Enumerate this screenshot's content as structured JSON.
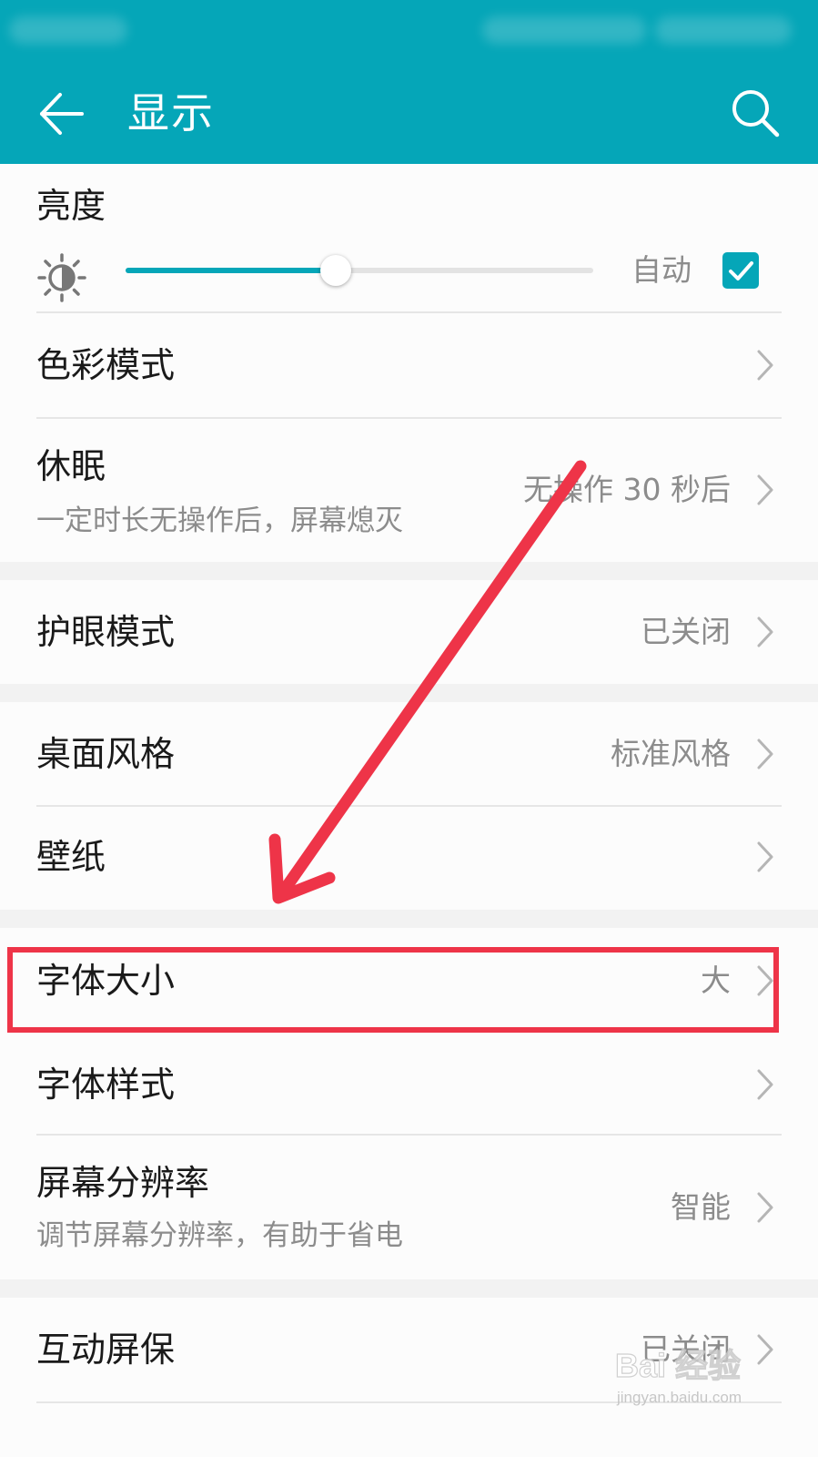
{
  "header": {
    "title": "显示"
  },
  "colors": {
    "accent": "#05a6b8",
    "annotation_red": "#ee3448"
  },
  "brightness": {
    "label": "亮度",
    "auto_label": "自动",
    "auto_checked": true,
    "level_fraction": 0.45
  },
  "settings": {
    "color_mode": {
      "label": "色彩模式"
    },
    "sleep": {
      "label": "休眠",
      "subtitle": "一定时长无操作后，屏幕熄灭",
      "value": "无操作 30 秒后"
    },
    "eye_comfort": {
      "label": "护眼模式",
      "value": "已关闭"
    },
    "home_style": {
      "label": "桌面风格",
      "value": "标准风格"
    },
    "wallpaper": {
      "label": "壁纸"
    },
    "font_size": {
      "label": "字体大小",
      "value": "大"
    },
    "font_style": {
      "label": "字体样式"
    },
    "resolution": {
      "label": "屏幕分辨率",
      "subtitle": "调节屏幕分辨率，有助于省电",
      "value": "智能"
    },
    "screensaver": {
      "label": "互动屏保",
      "value": "已关闭"
    }
  },
  "watermark": {
    "brand": "Bai 经验",
    "url": "jingyan.baidu.com"
  },
  "icons": {
    "back": "arrow-left-icon",
    "search": "search-icon",
    "brightness": "brightness-sun-icon",
    "chevron": "chevron-right-icon",
    "check": "check-icon"
  }
}
